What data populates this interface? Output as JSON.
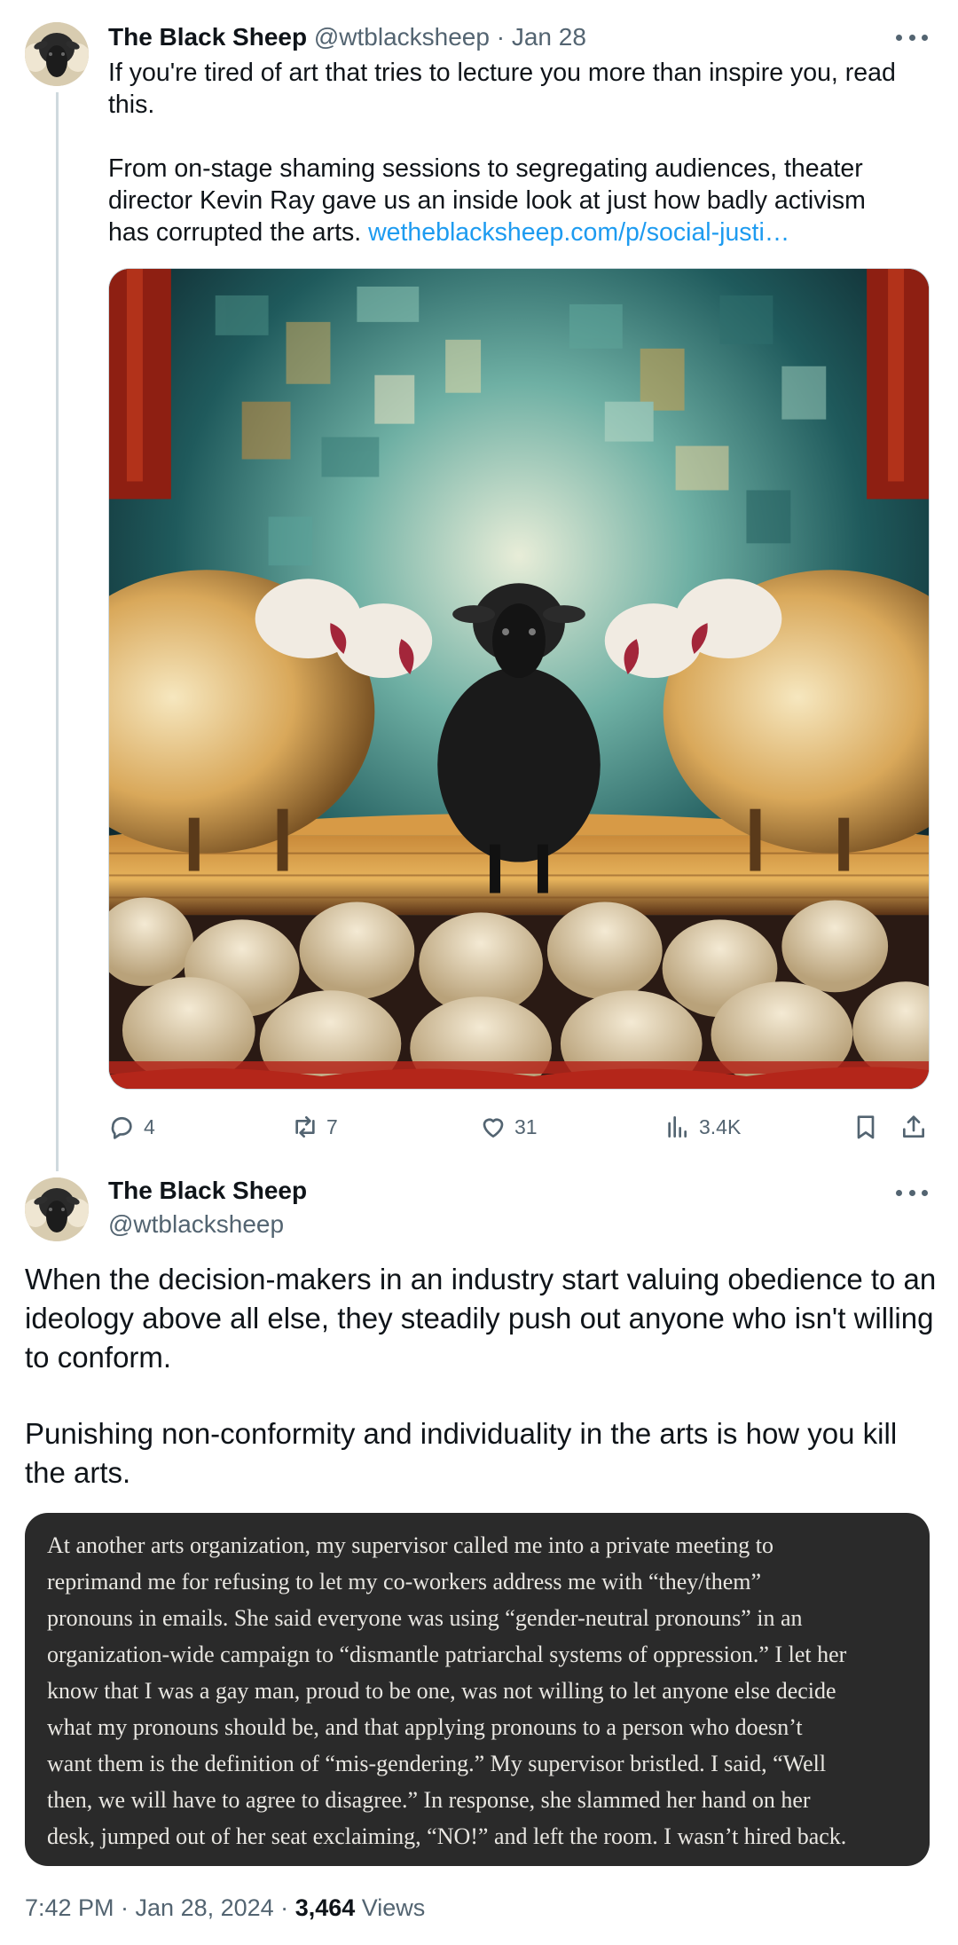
{
  "parent_tweet": {
    "display_name": "The Black Sheep",
    "handle": "@wtblacksheep",
    "separator": "·",
    "date": "Jan 28",
    "paragraph1": "If you're tired of art that tries to lecture you more than inspire you, read this.",
    "paragraph2": "From on-stage shaming sessions to segregating audiences, theater director Kevin Ray gave us an inside look at just how badly activism has corrupted the arts.",
    "link_text": "wetheblacksheep.com/p/social-justi…",
    "media_icon": "painting-black-sheep-on-stage",
    "actions": {
      "replies": "4",
      "reposts": "7",
      "likes": "31",
      "views": "3.4K"
    }
  },
  "main_tweet": {
    "display_name": "The Black Sheep",
    "handle": "@wtblacksheep",
    "paragraph1": "When the decision-makers in an industry start valuing obedience to an ideology above all else, they steadily push out anyone who isn't willing to conform.",
    "paragraph2": "Punishing non-conformity and individuality in the arts is how you kill the arts.",
    "quote_image_text": [
      "At another arts organization, my supervisor called me into a private meeting to",
      "reprimand me for refusing to let my co-workers address me with “they/them”",
      "pronouns in emails. She said everyone was using “gender-neutral pronouns” in an",
      "organization-wide campaign to “dismantle patriarchal systems of oppression.” I let her",
      "know that I was a gay man, proud to be one, was not willing to let anyone else decide",
      "what my pronouns should be, and that applying pronouns to a person who doesn’t",
      "want them is the definition of “mis-gendering.” My supervisor bristled. I said, “Well",
      "then, we will have to agree to disagree.” In response, she slammed her hand on her",
      "desk, jumped out of her seat exclaiming, “NO!” and left the room. I wasn’t hired back."
    ],
    "timestamp": "7:42 PM · Jan 28, 2024 · ",
    "view_count": "3,464",
    "views_label": " Views"
  },
  "colors": {
    "link": "#1d9bf0",
    "muted": "#536471",
    "text": "#0f1419",
    "thread_line": "#cfd9de",
    "quote_bg": "#2a2a2a"
  },
  "icons": [
    "reply-icon",
    "repost-icon",
    "like-icon",
    "views-icon",
    "bookmark-icon",
    "share-icon",
    "more-icon"
  ]
}
